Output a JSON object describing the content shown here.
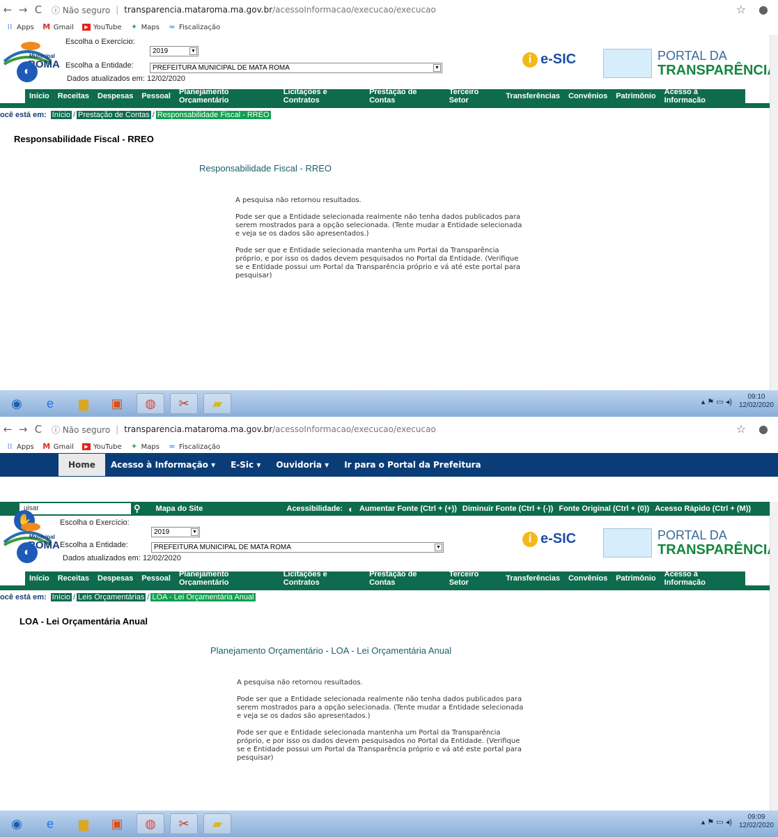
{
  "browser": {
    "url_info": "Não seguro",
    "url_host": "transparencia.mataroma.ma.gov.br",
    "url_path": "/acessoInformacao/execucao/execucao",
    "bookmarks": [
      "Apps",
      "Gmail",
      "YouTube",
      "Maps",
      "Fiscalização"
    ]
  },
  "topnav": {
    "home": "Home",
    "items": [
      "Acesso à Informação ▾",
      "E-Sic ▾",
      "Ouvidoria ▾",
      "Ir para o Portal da Prefeitura"
    ]
  },
  "accbar": {
    "search_placeholder": "uisar",
    "mapa": "Mapa do Site",
    "acessibilidade": "Acessibilidade:",
    "items": [
      "Aumentar Fonte (Ctrl + (+))",
      "Diminuir Fonte (Ctrl + (-))",
      "Fonte Original (Ctrl + (0))",
      "Acesso Rápido (Ctrl + (M))"
    ]
  },
  "header": {
    "exercicio_label": "Escolha o Exercício:",
    "exercicio_value": "2019",
    "entidade_label": "Escolha a Entidade:",
    "entidade_value": "PREFEITURA MUNICIPAL DE MATA ROMA",
    "atualizados": "Dados atualizados em: 12/02/2020",
    "logo_text": "ROMA",
    "logo_small": "Municipal",
    "esic": "e-SIC",
    "portal_l1": "PORTAL DA",
    "portal_l2": "TRANSPARÊNCIA"
  },
  "menu": [
    "Início",
    "Receitas",
    "Despesas",
    "Pessoal",
    "Planejamento Orçamentário",
    "Licitações e Contratos",
    "Prestação de Contas",
    "Terceiro Setor",
    "Transferências",
    "Convênios",
    "Patrimônio",
    "Acesso à Informação"
  ],
  "shot1": {
    "crumb_label": "ocê está em:",
    "crumbs": [
      "Início",
      "Prestação de Contas",
      "Responsabilidade Fiscal - RREO"
    ],
    "page_title": "Responsabilidade Fiscal - RREO",
    "sub_title": "Responsabilidade Fiscal - RREO",
    "clock_time": "09:10",
    "clock_date": "12/02/2020"
  },
  "shot2": {
    "crumb_label": "ocê está em:",
    "crumbs": [
      "Início",
      "Leis Orçamentárias",
      "LOA - Lei Orçamentária Anual"
    ],
    "page_title": "LOA - Lei Orçamentária Anual",
    "sub_title": "Planejamento Orçamentário - LOA - Lei Orçamentária Anual",
    "clock_time": "09:09",
    "clock_date": "12/02/2020"
  },
  "message": {
    "p1": "A pesquisa não retornou resultados.",
    "p2": "Pode ser que a Entidade selecionada realmente não tenha dados publicados para serem mostrados para a opção selecionada. (Tente mudar a Entidade selecionada e veja se os dados são apresentados.)",
    "p3": "Pode ser que e Entidade selecionada mantenha um Portal da Transparência próprio, e por isso os dados devem pesquisados no Portal da Entidade. (Verifique se e Entidade possui um Portal da Transparência próprio e vá até este portal para pesquisar)"
  }
}
